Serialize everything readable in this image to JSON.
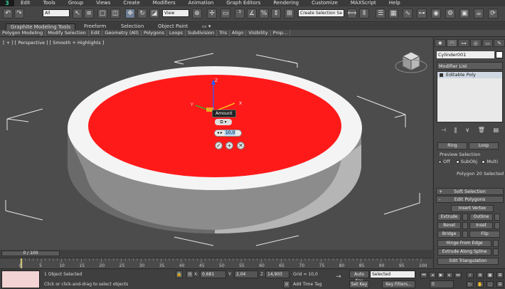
{
  "menu": {
    "logo": "3",
    "items": [
      "Edit",
      "Tools",
      "Group",
      "Views",
      "Create",
      "Modifiers",
      "Animation",
      "Graph Editors",
      "Rendering",
      "Customize",
      "MAXScript",
      "Help"
    ]
  },
  "toolbar": {
    "filter_value": "All",
    "view_value": "View",
    "selection_set_value": "Create Selection Se"
  },
  "ribbon": {
    "tabs": [
      "Graphite Modeling Tools",
      "Freeform",
      "Selection",
      "Object Paint"
    ],
    "panels": [
      "Polygon Modeling",
      "Modify Selection",
      "Edit",
      "Geometry (All)",
      "Polygons",
      "Loops",
      "Subdivision",
      "Tris",
      "Align",
      "Visibility",
      "Prop..."
    ]
  },
  "viewport": {
    "label": "[ + ] [ Perspective ] [ Smooth + Highlights ]",
    "caddy": {
      "tooltip": "Amount",
      "mode_label": "⧉ ▾",
      "spinner_arrow": "◂ ▸",
      "spinner_value": "10,0",
      "ok": "✓",
      "apply": "+",
      "cancel": "✕"
    }
  },
  "command_panel": {
    "object_name": "Cylinder001",
    "modifier_list": "Modifier List",
    "stack_item": "Editable Poly",
    "ring_label": "Ring",
    "loop_label": "Loop",
    "preview_selection_title": "Preview Selection",
    "preview_off": "Off",
    "preview_subobj": "SubObj",
    "preview_multi": "Multi",
    "selection_status": "Polygon 20 Selected",
    "soft_selection": "Soft Selection",
    "edit_polygons": "Edit Polygons",
    "insert_vertex": "Insert Vertex",
    "extrude": "Extrude",
    "outline": "Outline",
    "bevel": "Bevel",
    "inset": "Inset",
    "bridge": "Bridge",
    "flip": "Flip",
    "hinge_from_edge": "Hinge From Edge",
    "extrude_along_spline": "Extrude Along Spline",
    "edit_triangulation": "Edit Triangulation"
  },
  "timeline": {
    "slider_label": "0 / 100",
    "ticks": [
      "0",
      "5",
      "10",
      "15",
      "20",
      "25",
      "30",
      "35",
      "40",
      "45",
      "50",
      "55",
      "60",
      "65",
      "70",
      "75",
      "80",
      "85",
      "90",
      "95",
      "100"
    ]
  },
  "status": {
    "objects_selected": "1 Object Selected",
    "prompt": "Click or click-and-drag to select objects",
    "x_label": "X:",
    "x_value": "0,681",
    "y_label": "Y:",
    "y_value": "2,04",
    "z_label": "Z:",
    "z_value": "14,903",
    "grid": "Grid = 10,0",
    "add_time_tag": "Add Time Tag",
    "auto_key": "Auto Key",
    "auto_key_mode": "Selected",
    "set_key": "Set Key",
    "key_filters": "Key Filters...",
    "frame_value": "0"
  },
  "colors": {
    "selected_polygon": "#ff1a1a",
    "viewport_bg": "#4c4c4c",
    "ui_dark": "#3f3f3f"
  }
}
